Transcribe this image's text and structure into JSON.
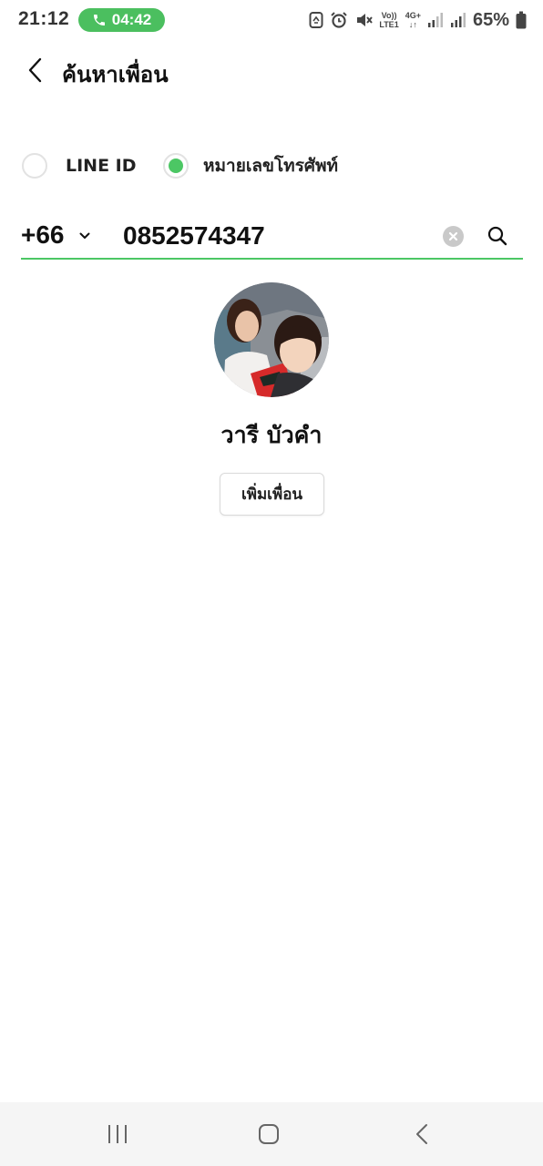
{
  "status_bar": {
    "time": "21:12",
    "call_duration": "04:42",
    "network_top": "Vo))",
    "network_bottom": "LTE1",
    "network_type": "4G+",
    "battery_percent": "65%",
    "icons": [
      "recycle-icon",
      "alarm-icon",
      "mute-icon",
      "signal-icon",
      "signal-icon",
      "battery-icon"
    ]
  },
  "header": {
    "title": "ค้นหาเพื่อน",
    "back_icon": "chevron-left-icon"
  },
  "search_type": {
    "options": [
      {
        "label": "LINE ID",
        "selected": false
      },
      {
        "label": "หมายเลขโทรศัพท์",
        "selected": true
      }
    ]
  },
  "phone_search": {
    "country_code": "+66",
    "number": "0852574347"
  },
  "result": {
    "name": "วารี บัวคำ",
    "add_button_label": "เพิ่มเพื่อน"
  },
  "nav_bar": {
    "buttons": [
      "recents-icon",
      "home-icon",
      "back-icon"
    ]
  },
  "colors": {
    "accent": "#4cc764",
    "call_pill": "#4bbf5f",
    "nav_background": "#f5f5f5",
    "clear_button": "#c9c9c9"
  }
}
